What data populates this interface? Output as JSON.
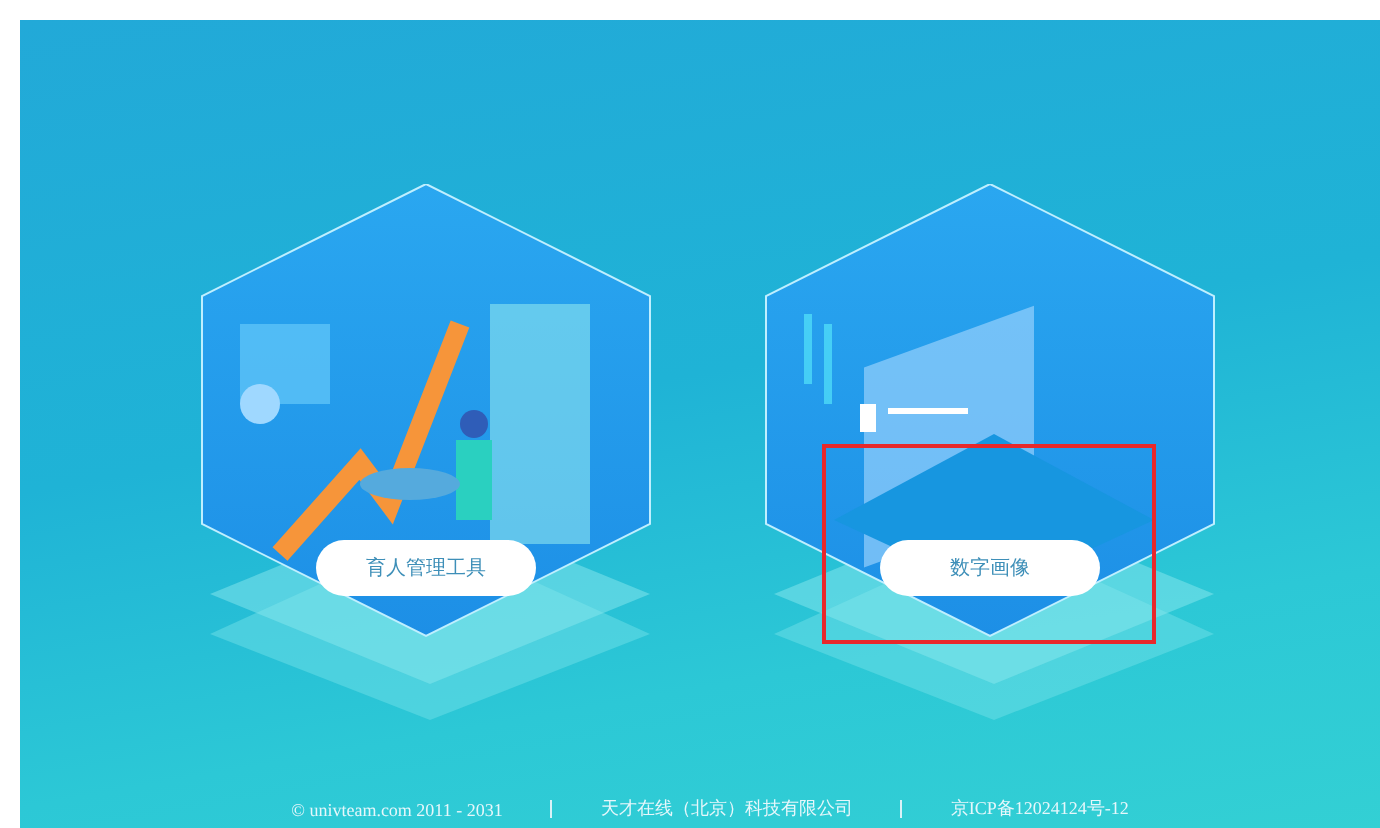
{
  "cards": [
    {
      "label": "育人管理工具",
      "selected": false
    },
    {
      "label": "数字画像",
      "selected": true
    }
  ],
  "footer": [
    "© univteam.com 2011 - 2031",
    "天才在线（北京）科技有限公司",
    "京ICP备12024124号-12"
  ]
}
